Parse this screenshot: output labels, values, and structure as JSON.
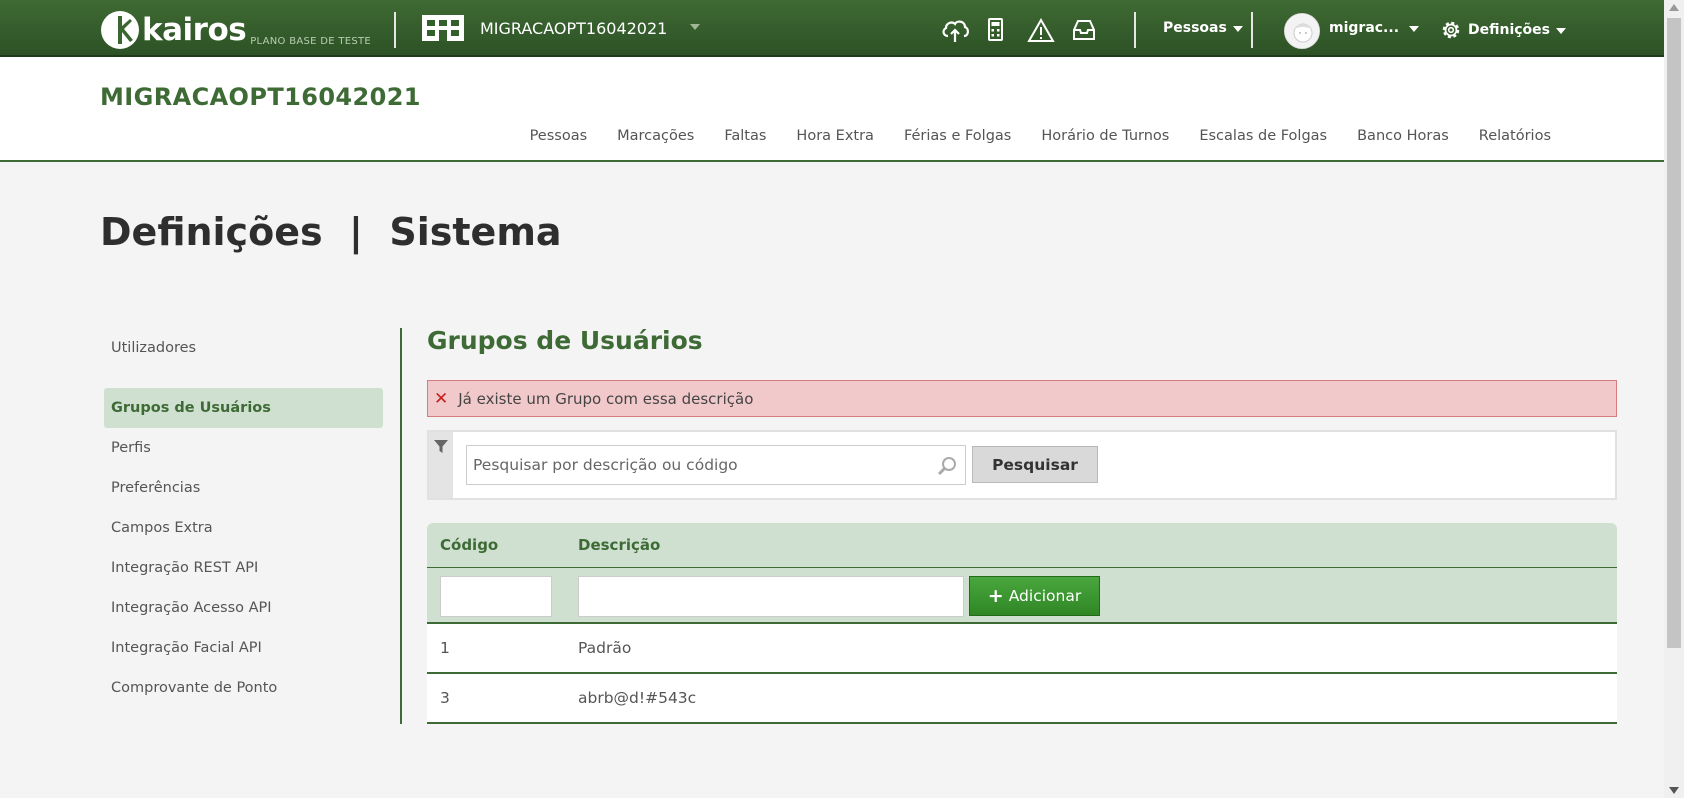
{
  "topbar": {
    "logo_text": "kairos",
    "logo_subtitle": "PLANO BASE DE TESTE",
    "company_name": "MIGRACAOPT16042021",
    "people_menu": "Pessoas",
    "user_name": "migrac...",
    "settings_menu": "Definições"
  },
  "header": {
    "title": "MIGRACAOPT16042021",
    "nav": [
      "Pessoas",
      "Marcações",
      "Faltas",
      "Hora Extra",
      "Férias e Folgas",
      "Horário de Turnos",
      "Escalas de Folgas",
      "Banco Horas",
      "Relatórios"
    ]
  },
  "page_title": "Definições  |  Sistema",
  "sidebar": {
    "items": [
      {
        "label": "Utilizadores",
        "active": false
      },
      {
        "label": "Grupos de Usuários",
        "active": true
      },
      {
        "label": "Perfis",
        "active": false
      },
      {
        "label": "Preferências",
        "active": false
      },
      {
        "label": "Campos Extra",
        "active": false
      },
      {
        "label": "Integração REST API",
        "active": false
      },
      {
        "label": "Integração Acesso API",
        "active": false
      },
      {
        "label": "Integração Facial API",
        "active": false
      },
      {
        "label": "Comprovante de Ponto",
        "active": false
      }
    ]
  },
  "main": {
    "section_title": "Grupos de Usuários",
    "alert_text": "Já existe um Grupo com essa descrição",
    "search": {
      "placeholder": "Pesquisar por descrição ou código",
      "value": "",
      "button_label": "Pesquisar"
    },
    "table": {
      "columns": [
        "Código",
        "Descrição"
      ],
      "add_row": {
        "code_value": "",
        "description_value": "",
        "button_label": "Adicionar"
      },
      "rows": [
        {
          "code": "1",
          "description": "Padrão"
        },
        {
          "code": "3",
          "description": "abrb@d!#543c"
        }
      ]
    }
  },
  "colors": {
    "brand_green": "#3e6b35",
    "topbar_green": "#34602c",
    "active_bg": "#cfe0d1",
    "alert_bg": "#f2c9cb",
    "add_button": "#3a9a2f"
  },
  "icons": {
    "company": "building-icon",
    "cloud": "cloud-upload-icon",
    "calculator": "calculator-icon",
    "warning": "warning-icon",
    "inbox": "inbox-icon",
    "settings": "gear-icon",
    "filter": "filter-icon",
    "search": "search-icon",
    "alert": "close-icon",
    "add": "plus-icon"
  }
}
